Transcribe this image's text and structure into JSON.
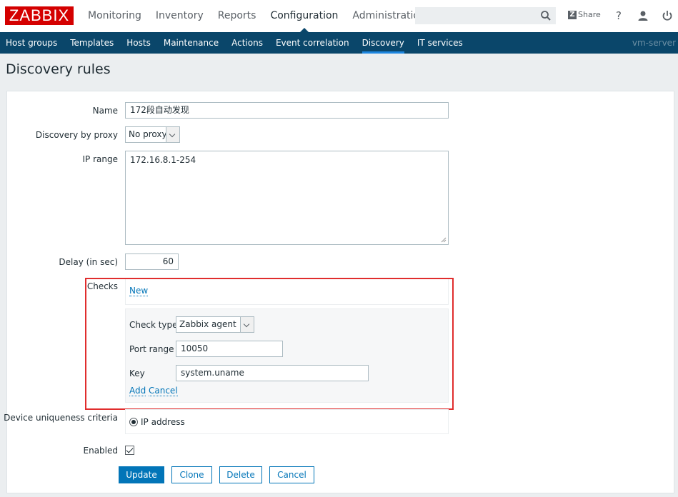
{
  "app": {
    "logo": "ZABBIX",
    "server": "vm-server"
  },
  "main_menu": [
    "Monitoring",
    "Inventory",
    "Reports",
    "Configuration",
    "Administration"
  ],
  "active_main": "Configuration",
  "header_tools": {
    "share_label": "Share",
    "help_label": "?"
  },
  "sub_menu": [
    "Host groups",
    "Templates",
    "Hosts",
    "Maintenance",
    "Actions",
    "Event correlation",
    "Discovery",
    "IT services"
  ],
  "active_sub": "Discovery",
  "page_title": "Discovery rules",
  "form": {
    "name_label": "Name",
    "name_value": "172段自动发现",
    "proxy_label": "Discovery by proxy",
    "proxy_value": "No proxy",
    "ip_label": "IP range",
    "ip_value": "172.16.8.1-254",
    "delay_label": "Delay (in sec)",
    "delay_value": "60",
    "checks_label": "Checks",
    "checks_new": "New",
    "check_type_label": "Check type",
    "check_type_value": "Zabbix agent",
    "port_label": "Port range",
    "port_value": "10050",
    "key_label": "Key",
    "key_value": "system.uname",
    "add_link": "Add",
    "cancel_link": "Cancel",
    "uniq_label": "Device uniqueness criteria",
    "uniq_value": "IP address",
    "enabled_label": "Enabled",
    "enabled_checked": true
  },
  "buttons": {
    "update": "Update",
    "clone": "Clone",
    "delete": "Delete",
    "cancel": "Cancel"
  },
  "colors": {
    "brand": "#d40000",
    "nav": "#0a466a",
    "link": "#0275b8",
    "highlight": "#e02d2d"
  }
}
